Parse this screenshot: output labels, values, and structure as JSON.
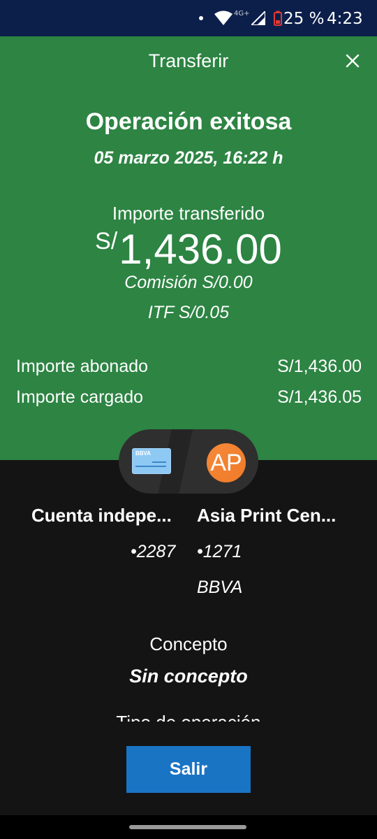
{
  "status_bar": {
    "network": "4G+",
    "battery_percent": "25 %",
    "time": "4:23"
  },
  "header": {
    "title": "Transferir"
  },
  "result": {
    "title": "Operación exitosa",
    "datetime": "05 marzo 2025, 16:22 h",
    "amount_label": "Importe transferido",
    "amount_currency": "S/",
    "amount_value": "1,436.00",
    "commission": "Comisión S/0.00",
    "itf": "ITF S/0.05"
  },
  "summary": [
    {
      "label": "Importe abonado",
      "value": "S/1,436.00"
    },
    {
      "label": "Importe cargado",
      "value": "S/1,436.05"
    }
  ],
  "origin_account": {
    "card_brand": "BBVA",
    "name": "Cuenta indepe...",
    "number": "•2287"
  },
  "destination_account": {
    "initials": "AP",
    "name": "Asia Print Cen...",
    "number": "•1271",
    "bank": "BBVA"
  },
  "concept": {
    "label": "Concepto",
    "value": "Sin concepto"
  },
  "operation_type": {
    "label": "Tipo de operación"
  },
  "exit_button": {
    "label": "Salir"
  },
  "colors": {
    "status_bar": "#0c1f4a",
    "header_green": "#2d8443",
    "background": "#141414",
    "button_blue": "#1a74c4",
    "avatar_orange": "#f58a3a"
  }
}
